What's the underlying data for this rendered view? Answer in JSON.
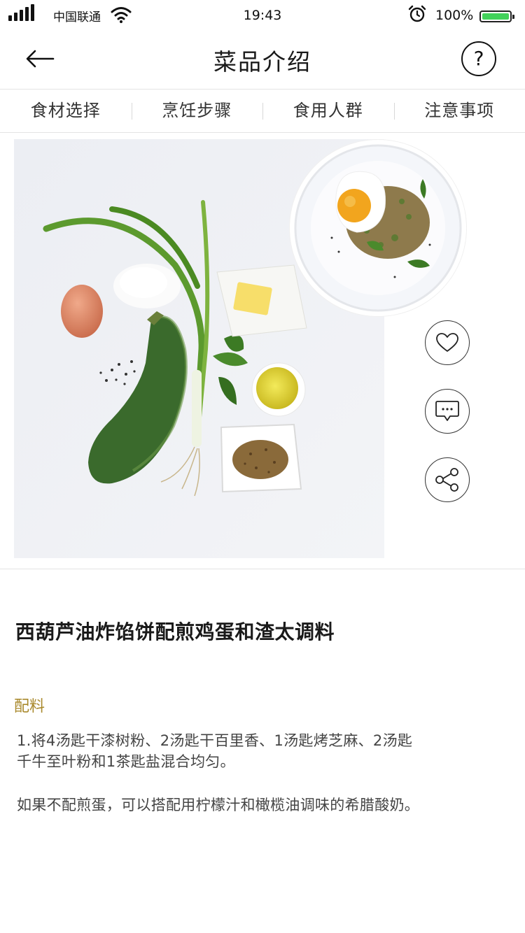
{
  "status_bar": {
    "carrier": "中国联通",
    "time": "19:43",
    "battery_percent": "100%",
    "battery_level": 1.0,
    "battery_color": "#41d15a",
    "icons": [
      "signal-icon",
      "wifi-icon",
      "alarm-icon",
      "battery-icon"
    ]
  },
  "nav": {
    "title": "菜品介绍",
    "back_icon": "arrow-left-icon",
    "help_label": "?"
  },
  "tabs": [
    {
      "label": "食材选择"
    },
    {
      "label": "烹饪步骤"
    },
    {
      "label": "食用人群"
    },
    {
      "label": "注意事项"
    }
  ],
  "actions": [
    {
      "icon": "heart-icon"
    },
    {
      "icon": "comment-icon"
    },
    {
      "icon": "share-icon"
    }
  ],
  "dish": {
    "title": "西葫芦油炸馅饼配煎鸡蛋和渣太调料",
    "section_label": "配料",
    "paragraph_1_line_1": "1.将4汤匙干漆树粉、2汤匙干百里香、1汤匙烤芝麻、2汤匙",
    "paragraph_1_line_2": "千牛至叶粉和1茶匙盐混合均匀。",
    "paragraph_2": "如果不配煎蛋，可以搭配用柠檬汁和橄榄油调味的希腊酸奶。"
  },
  "colors": {
    "accent": "#a9892c",
    "divider": "#e3e3e3",
    "text": "#444444"
  }
}
